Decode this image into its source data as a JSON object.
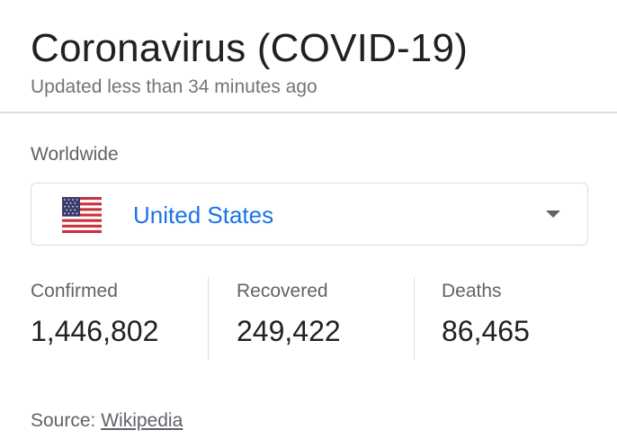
{
  "header": {
    "title": "Coronavirus (COVID-19)",
    "subtitle": "Updated less than 34 minutes ago"
  },
  "region": {
    "label": "Worldwide",
    "selected": "United States",
    "flag_icon": "us-flag-icon",
    "dropdown_icon": "caret-down-icon"
  },
  "stats": [
    {
      "label": "Confirmed",
      "value": "1,446,802"
    },
    {
      "label": "Recovered",
      "value": "249,422"
    },
    {
      "label": "Deaths",
      "value": "86,465"
    }
  ],
  "source": {
    "prefix": "Source:",
    "link_text": "Wikipedia"
  },
  "colors": {
    "link_blue": "#1a73e8",
    "text_primary": "#202124",
    "text_secondary": "#5f6368",
    "border": "#dadce0"
  }
}
